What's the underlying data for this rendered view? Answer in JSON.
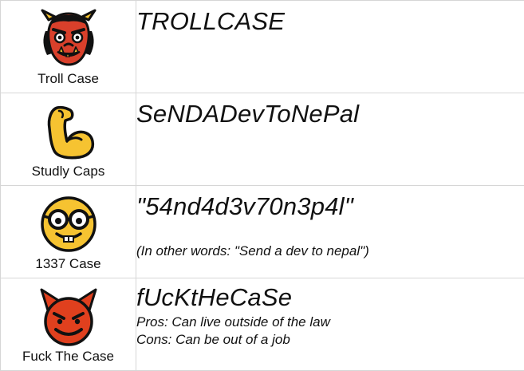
{
  "rows": [
    {
      "icon": "ogre-icon",
      "label": "Troll Case",
      "text": "TROLLCASE"
    },
    {
      "icon": "flexed-biceps-icon",
      "label": "Studly Caps",
      "text": "SeNDADevToNePal"
    },
    {
      "icon": "nerd-face-icon",
      "label": "1337 Case",
      "text": "\"54nd4d3v70n3p4l\"",
      "note": "(In other words: \"Send a dev to nepal\")"
    },
    {
      "icon": "smiling-devil-icon",
      "label": "Fuck The Case",
      "text": "fUcKtHeCaSe",
      "pros": "Pros: Can live outside of the law",
      "cons": "Cons: Can be out of a job"
    }
  ],
  "colors": {
    "grid_border": "#d6d6d6",
    "ogre_red": "#d9402b",
    "biceps_yellow": "#f6c331",
    "nerd_yellow": "#f6c331",
    "devil_red": "#e0401e"
  }
}
